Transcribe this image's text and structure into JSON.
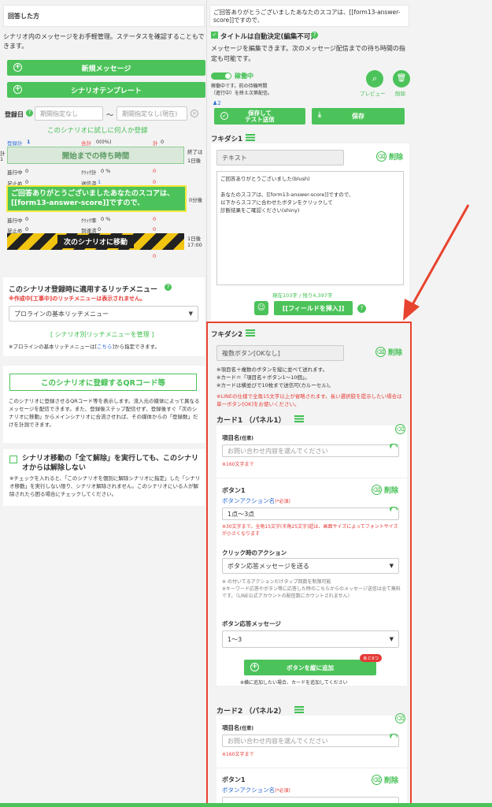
{
  "left": {
    "header_title": "回答した方",
    "desc": "シナリオ内のメッセージをお手軽管理。ステータスを確認することもできます。",
    "new_message": "新規メッセージ",
    "scenario_template": "シナリオテンプレート",
    "reg_date_label": "登録日",
    "date_from_placeholder": "期間指定なし",
    "tilde": "〜",
    "date_to_placeholder": "期間指定なし(現在)",
    "trial_register": "このシナリオに試しに何人か登録",
    "stats_row1": {
      "registered": "登録計",
      "registered_val": "1",
      "total": "合計",
      "total_val": "0(0%)",
      "blocked_total": "計",
      "blocked_total_val": "0"
    },
    "wait_time": "開始までの待ち時間",
    "left_edge_a": "計",
    "left_edge_b": "1",
    "end_label": "終了は",
    "end_value": "1日後",
    "stats_row2": {
      "progress": "進行中",
      "progress_val": "0",
      "click_total": "ｸﾘｯｸ計",
      "click_total_val": "0 %",
      "blocked": "0"
    },
    "stats_row3": {
      "done": "足止め",
      "done_val": "0",
      "sent": "送信済",
      "sent_val": "1",
      "blocked": "0"
    },
    "message_banner": "ご回答ありがとうございましたあなたのスコアは、[[form13-answer-score]]ですので、",
    "zero_days": "0分後",
    "stats_row4": {
      "progress": "進行中",
      "progress_val": "0",
      "click_rate": "ｸﾘｯｸ率",
      "click_rate_val": "0 %",
      "blocked": "0"
    },
    "stats_row5": {
      "done": "足止め",
      "done_val": "0",
      "reached": "到達済",
      "reached_val": "0",
      "blocked": "0"
    },
    "next_scenario": "次のシナリオに移動",
    "next_time_a": "1日後",
    "next_time_b": "17:00",
    "after_blocked": "0",
    "rich_menu_title": "このシナリオ登録時に適用するリッチメニュー",
    "rich_menu_warning": "※作成中[工事中]のリッチメニューは表示されません。",
    "rich_menu_select": "プロラインの基本リッチメニュー",
    "rich_menu_manage": "[ シナリオ別リッチメニューを管理 ]",
    "rich_menu_note_a": "※プロラインの基本リッチメニューは[",
    "rich_menu_note_link": "こちら",
    "rich_menu_note_b": "]から指定できます。",
    "qr_button": "このシナリオに登録するQRコード等",
    "qr_desc": "このシナリオに登録させるQRコード等を表示します。流入元の媒体によって異なるメッセージを配信できます。また、登録後ステップ配信せず、登録後すぐ「次のシナリオに移動」からメインシナリオに合流させれば、その媒体からの「登録数」だけを計測できます。",
    "unlock_title": "シナリオ移動の「全て解除」を実行しても、このシナリオからは解除しない",
    "unlock_desc": "※チェックを入れると、「このシナリオを個別に解除シナリオに指定」した「シナリオ移動」を実行しない限り、シナリオ解除されません。このシナリオにいる人が解除されたら困る場合にチェックしてください。"
  },
  "right": {
    "top_message": "ご回答ありがとうございましたあなたのスコアは、[[form13-answer-score]]ですので、",
    "title_auto": "タイトルは自動決定(編集不可)",
    "edit_desc": "メッセージを編集できます。次のメッセージ配信までの待ち時間の指定も可能です。",
    "running": "稼働中",
    "running_desc_a": "稼働中です。前の待機時間",
    "running_desc_b": "（進行中）を終え次第配信。",
    "preview": "プレビュー",
    "delete": "削除",
    "count_label": "2",
    "save_test": "保存して\nテスト送信",
    "save": "保存",
    "bubble1_title": "フキダシ1",
    "bubble1_type": "テキスト",
    "bubble_delete": "削除",
    "bubble1_text": "ご回答ありがとうございました(blush)\n\nあなたのスコアは、[[form13-answer-score]]ですので、\n以下からスコアに合わせたボタンをクリックして\n診断結果をご確認ください(shiny)",
    "char_count": "現在103字 / 残り4,397字",
    "insert_field": "[[フィールドを挿入]]",
    "bubble2_title": "フキダシ2",
    "bubble2_type": "複数ボタン[OKなし]",
    "bubble2_note": "※項目名＋複数のボタンを縦に並べて送れます。\n※カード＝「項目名＋ボタン1〜10個」。\n※カードは横並びで10枚まで送信可(カルーセル)。",
    "bubble2_warn": "※LINEの仕様で全角15文字以上が省略されます。長い選択肢を提示したい場合は単一ボタン[OK]をお使いください。",
    "card1_title": "カード1 （パネル1）",
    "item_name_label": "項目名",
    "optional": "(任意)",
    "item_placeholder": "お問い合わせ内容を選んでください",
    "item_limit": "※160文字まで",
    "button1_label": "ボタン1",
    "button_delete": "削除",
    "button_action_name": "ボタンアクション名",
    "required": "(*必須)",
    "button1_value": "1点〜3点",
    "button_limit": "※30文字まで。全角15文字(半角25文字)超は、画面サイズによってフォントサイズが小さくなります",
    "click_action_label": "クリック時のアクション",
    "click_action_value": "ボタン応答メッセージを送る",
    "click_note": "※ の付いてるアクションだけタップ回数を制限可能\n※キーワード応答やボタン等に応答した時のこちらからのメッセージ送信は全て無料です。（LINE公式アカウントの配信数にカウントされません）",
    "reply_msg_label": "ボタン応答メッセージ",
    "reply_msg_value": "1〜3",
    "add_button": "ボタンを縦に追加",
    "remaining_badge": "あと9つ",
    "add_card_note": "※横に追加したい場合、カードを追加してください",
    "card2_title": "カード2 （パネル2）",
    "card2_item_placeholder": "お問い合わせ内容を選んでください",
    "card2_button1": "ボタン1",
    "card2_action_name": "ボタンアクション名"
  },
  "colors": {
    "accent": "#4cc35a",
    "warning": "#e53935",
    "link": "#2b6cd6",
    "highlight": "#f5e83a",
    "callout": "#e8432e"
  }
}
